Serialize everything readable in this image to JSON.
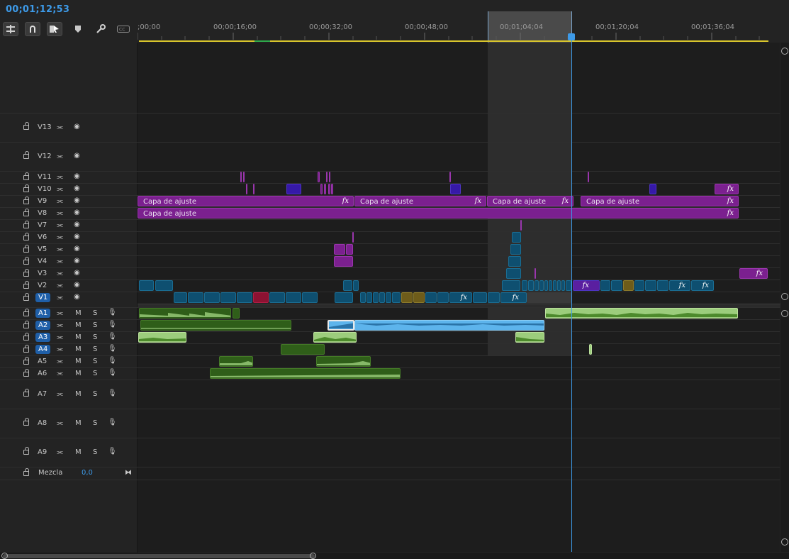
{
  "sequence": {
    "timecode": "00;01;12;53"
  },
  "tools": [
    {
      "name": "insert-sequence-nest-icon"
    },
    {
      "name": "snap-magnet-icon"
    },
    {
      "name": "linked-selection-icon"
    },
    {
      "name": "add-marker-icon"
    },
    {
      "name": "timeline-settings-wrench-icon"
    },
    {
      "name": "captions-cc-icon"
    }
  ],
  "ruler": {
    "labels": [
      ";00;00",
      "00;00;16;00",
      "00;00;32;00",
      "00;00;48;00",
      "00;01;04;04",
      "00;01;20;04",
      "00;01;36;04"
    ]
  },
  "tracks": {
    "video": [
      {
        "id": "V13",
        "label": "V13",
        "targeted": false
      },
      {
        "id": "V12",
        "label": "V12",
        "targeted": false
      },
      {
        "id": "V11",
        "label": "V11",
        "targeted": false
      },
      {
        "id": "V10",
        "label": "V10",
        "targeted": false
      },
      {
        "id": "V9",
        "label": "V9",
        "targeted": false
      },
      {
        "id": "V8",
        "label": "V8",
        "targeted": false
      },
      {
        "id": "V7",
        "label": "V7",
        "targeted": false
      },
      {
        "id": "V6",
        "label": "V6",
        "targeted": false
      },
      {
        "id": "V5",
        "label": "V5",
        "targeted": false
      },
      {
        "id": "V4",
        "label": "V4",
        "targeted": false
      },
      {
        "id": "V3",
        "label": "V3",
        "targeted": false
      },
      {
        "id": "V2",
        "label": "V2",
        "targeted": false
      },
      {
        "id": "V1",
        "label": "V1",
        "targeted": true
      }
    ],
    "audio": [
      {
        "id": "A1",
        "label": "A1",
        "targeted": true,
        "mute": "M",
        "solo": "S"
      },
      {
        "id": "A2",
        "label": "A2",
        "targeted": true,
        "mute": "M",
        "solo": "S"
      },
      {
        "id": "A3",
        "label": "A3",
        "targeted": true,
        "mute": "M",
        "solo": "S"
      },
      {
        "id": "A4",
        "label": "A4",
        "targeted": true,
        "mute": "M",
        "solo": "S"
      },
      {
        "id": "A5",
        "label": "A5",
        "targeted": false,
        "mute": "M",
        "solo": "S"
      },
      {
        "id": "A6",
        "label": "A6",
        "targeted": false,
        "mute": "M",
        "solo": "S"
      },
      {
        "id": "A7",
        "label": "A7",
        "targeted": false,
        "mute": "M",
        "solo": "S"
      },
      {
        "id": "A8",
        "label": "A8",
        "targeted": false,
        "mute": "M",
        "solo": "S"
      },
      {
        "id": "A9",
        "label": "A9",
        "targeted": false,
        "mute": "M",
        "solo": "S"
      }
    ],
    "mix": {
      "label": "Mezcla",
      "value": "0,0"
    }
  },
  "clips": {
    "adjustment_label": "Capa de ajuste",
    "fx_label": "fx"
  },
  "colors": {
    "timecode": "#3d9ae8",
    "playhead": "#3d9ae8",
    "work_area_bar": "#d8c52c",
    "adjustment_layer": "#7b208f",
    "video_clip": "#0e4f70",
    "audio_clip": "#2f5e19",
    "audio_clip_selected": "#9ccd7c",
    "audio_clip_active": "#5db4ec"
  }
}
